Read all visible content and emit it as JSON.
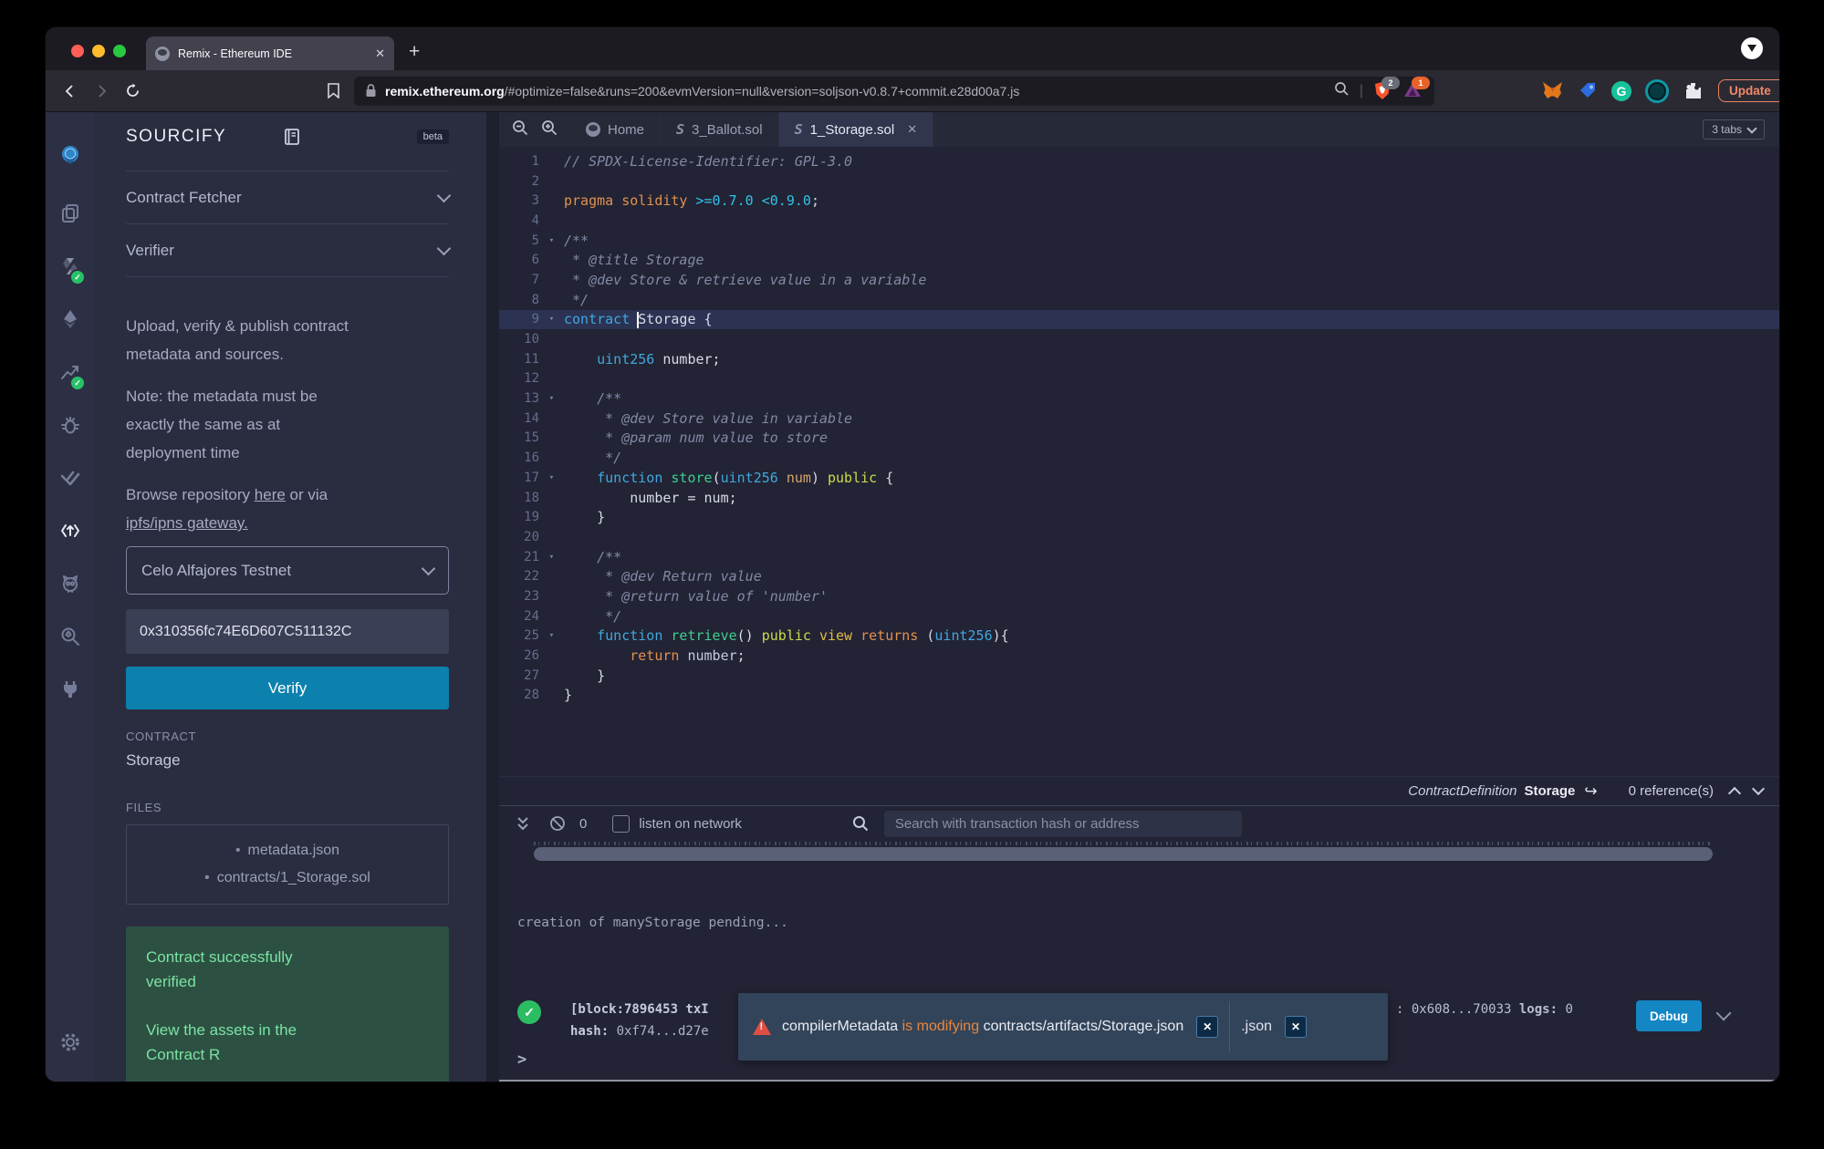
{
  "accent": {
    "verify_teal": "#0c81ae",
    "debug_blue": "#1486c4",
    "success_green": "#7ce3a3",
    "warn_orange": "#e8873f",
    "update_salmon": "#f08a6a"
  },
  "browser": {
    "tab_title": "Remix - Ethereum IDE",
    "url_host": "remix.ethereum.org",
    "url_path": "/#optimize=false&runs=200&evmVersion=null&version=soljson-v0.8.7+commit.e28d00a7.js",
    "shield_badge": "2",
    "triangle_badge": "1",
    "grammarly_letter": "G",
    "update_label": "Update"
  },
  "rail_icons": [
    "remix-logo",
    "file-explorer",
    "solidity-compiler",
    "deploy-run",
    "static-analysis",
    "debugger",
    "unit-testing",
    "sourcify",
    "owl-plugin",
    "etherscan",
    "plugin-manager",
    "settings-gear"
  ],
  "panel": {
    "title": "SOURCIFY",
    "beta": "beta",
    "section1": "Contract Fetcher",
    "section2": "Verifier",
    "desc1_l1": "Upload, verify & publish contract",
    "desc1_l2": "metadata and sources.",
    "note_l1": "Note: the metadata must be",
    "note_l2": "exactly the same as at",
    "note_l3": "deployment time",
    "browse_prefix": "Browse repository ",
    "browse_link1": "here",
    "browse_mid": " or via",
    "browse_link2": "ipfs/ipns gateway.",
    "network_value": "Celo Alfajores Testnet",
    "address_value": "0x310356fc74E6D607C511132C",
    "verify_label": "Verify",
    "contract_caption": "CONTRACT",
    "contract_name": "Storage",
    "files_caption": "FILES",
    "file1": "metadata.json",
    "file2": "contracts/1_Storage.sol",
    "success_l1": "Contract successfully",
    "success_l2": "verified",
    "success_l3": "View the assets in the",
    "success_l4": "Contract R"
  },
  "editor": {
    "tabs": [
      {
        "label": "Home"
      },
      {
        "label": "3_Ballot.sol"
      },
      {
        "label": "1_Storage.sol"
      }
    ],
    "tabs_badge": "3 tabs",
    "status": {
      "node_type": "ContractDefinition",
      "node_name": "Storage",
      "references": "0 reference(s)"
    },
    "code_lines": [
      {
        "n": 1,
        "tokens": [
          [
            "comment",
            "// SPDX-License-Identifier: GPL-3.0"
          ]
        ]
      },
      {
        "n": 2,
        "tokens": []
      },
      {
        "n": 3,
        "tokens": [
          [
            "orange",
            "pragma solidity "
          ],
          [
            "cyan",
            ">=0.7.0 <0.9.0"
          ],
          [
            "plain",
            ";"
          ]
        ]
      },
      {
        "n": 4,
        "tokens": []
      },
      {
        "n": 5,
        "fold": true,
        "tokens": [
          [
            "comment",
            "/**"
          ]
        ]
      },
      {
        "n": 6,
        "tokens": [
          [
            "comment",
            " * @title Storage"
          ]
        ]
      },
      {
        "n": 7,
        "tokens": [
          [
            "comment",
            " * @dev Store & retrieve value in a variable"
          ]
        ]
      },
      {
        "n": 8,
        "tokens": [
          [
            "comment",
            " */"
          ]
        ]
      },
      {
        "n": 9,
        "fold": true,
        "current": true,
        "tokens": [
          [
            "blue",
            "contract "
          ],
          [
            "cursor",
            ""
          ],
          [
            "plain",
            "Storage {"
          ]
        ]
      },
      {
        "n": 10,
        "tokens": []
      },
      {
        "n": 11,
        "tokens": [
          [
            "plain",
            "    "
          ],
          [
            "blue",
            "uint256"
          ],
          [
            "plain",
            " number;"
          ]
        ]
      },
      {
        "n": 12,
        "tokens": []
      },
      {
        "n": 13,
        "fold": true,
        "tokens": [
          [
            "comment",
            "    /**"
          ]
        ]
      },
      {
        "n": 14,
        "tokens": [
          [
            "comment",
            "     * @dev Store value in variable"
          ]
        ]
      },
      {
        "n": 15,
        "tokens": [
          [
            "comment",
            "     * @param num value to store"
          ]
        ]
      },
      {
        "n": 16,
        "tokens": [
          [
            "comment",
            "     */"
          ]
        ]
      },
      {
        "n": 17,
        "fold": true,
        "tokens": [
          [
            "plain",
            "    "
          ],
          [
            "blue",
            "function "
          ],
          [
            "green",
            "store"
          ],
          [
            "plain",
            "("
          ],
          [
            "blue",
            "uint256"
          ],
          [
            "param",
            " num"
          ],
          [
            "plain",
            ") "
          ],
          [
            "yellow",
            "public"
          ],
          [
            "plain",
            " {"
          ]
        ]
      },
      {
        "n": 18,
        "tokens": [
          [
            "plain",
            "        number = num;"
          ]
        ]
      },
      {
        "n": 19,
        "tokens": [
          [
            "plain",
            "    }"
          ]
        ]
      },
      {
        "n": 20,
        "tokens": []
      },
      {
        "n": 21,
        "fold": true,
        "tokens": [
          [
            "comment",
            "    /**"
          ]
        ]
      },
      {
        "n": 22,
        "tokens": [
          [
            "comment",
            "     * @dev Return value"
          ]
        ]
      },
      {
        "n": 23,
        "tokens": [
          [
            "comment",
            "     * @return value of 'number'"
          ]
        ]
      },
      {
        "n": 24,
        "tokens": [
          [
            "comment",
            "     */"
          ]
        ]
      },
      {
        "n": 25,
        "fold": true,
        "tokens": [
          [
            "plain",
            "    "
          ],
          [
            "blue",
            "function "
          ],
          [
            "green",
            "retrieve"
          ],
          [
            "plain",
            "() "
          ],
          [
            "yellow",
            "public"
          ],
          [
            "gold",
            " view"
          ],
          [
            "orange",
            " returns"
          ],
          [
            "plain",
            " ("
          ],
          [
            "blue",
            "uint256"
          ],
          [
            "plain",
            "){"
          ]
        ]
      },
      {
        "n": 26,
        "tokens": [
          [
            "plain",
            "        "
          ],
          [
            "orange",
            "return"
          ],
          [
            "ident",
            " number"
          ],
          [
            "plain",
            ";"
          ]
        ]
      },
      {
        "n": 27,
        "tokens": [
          [
            "plain",
            "    }"
          ]
        ]
      },
      {
        "n": 28,
        "tokens": [
          [
            "plain",
            "}"
          ]
        ]
      }
    ]
  },
  "terminal": {
    "count": "0",
    "listen_label": "listen on network",
    "search_placeholder": "Search with transaction hash or address",
    "pending_line": "creation of manyStorage pending...",
    "tx_line1": "[block:7896453 txI",
    "tx_hash_label": "hash: ",
    "tx_hash_value": "0xf74...d27e",
    "right_fragment": ": 0x608...70033 ",
    "logs_label": "logs:",
    "logs_value": " 0",
    "toast_name": "compilerMetadata",
    "toast_mid": " is ",
    "toast_action": "modifying",
    "toast_path": "contracts/artifacts/Storage.json",
    "toast_close": "✕",
    "toast2_label": ".json",
    "debug_label": "Debug",
    "prompt": ">",
    "ok_mark": "✓"
  }
}
